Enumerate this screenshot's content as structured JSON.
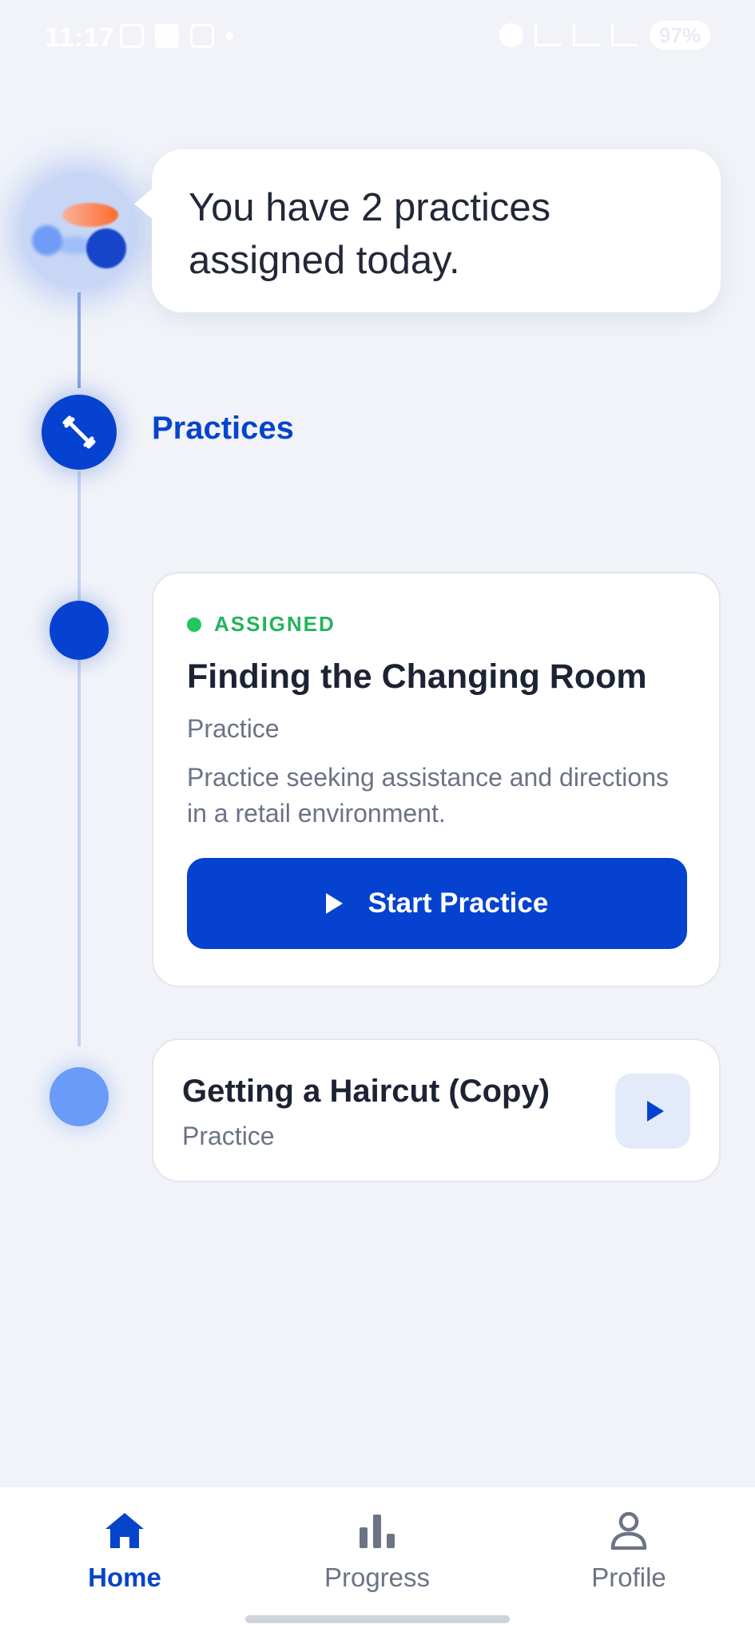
{
  "status_bar": {
    "time": "11:17",
    "battery": "97%"
  },
  "assistant": {
    "message": "You have 2 practices assigned today."
  },
  "section": {
    "title": "Practices"
  },
  "practices": [
    {
      "status": "ASSIGNED",
      "title": "Finding the Changing Room",
      "type": "Practice",
      "description": "Practice seeking assistance and directions in a retail environment.",
      "button_label": "Start Practice"
    },
    {
      "title": "Getting a Haircut (Copy)",
      "type": "Practice"
    }
  ],
  "nav": {
    "items": [
      {
        "label": "Home",
        "icon": "home-icon",
        "active": true
      },
      {
        "label": "Progress",
        "icon": "bar-chart-icon",
        "active": false
      },
      {
        "label": "Profile",
        "icon": "person-icon",
        "active": false
      }
    ]
  },
  "colors": {
    "accent": "#0642d0",
    "background": "#f1f3f8",
    "assigned_green": "#22c55e",
    "muted_text": "#6b7385"
  }
}
